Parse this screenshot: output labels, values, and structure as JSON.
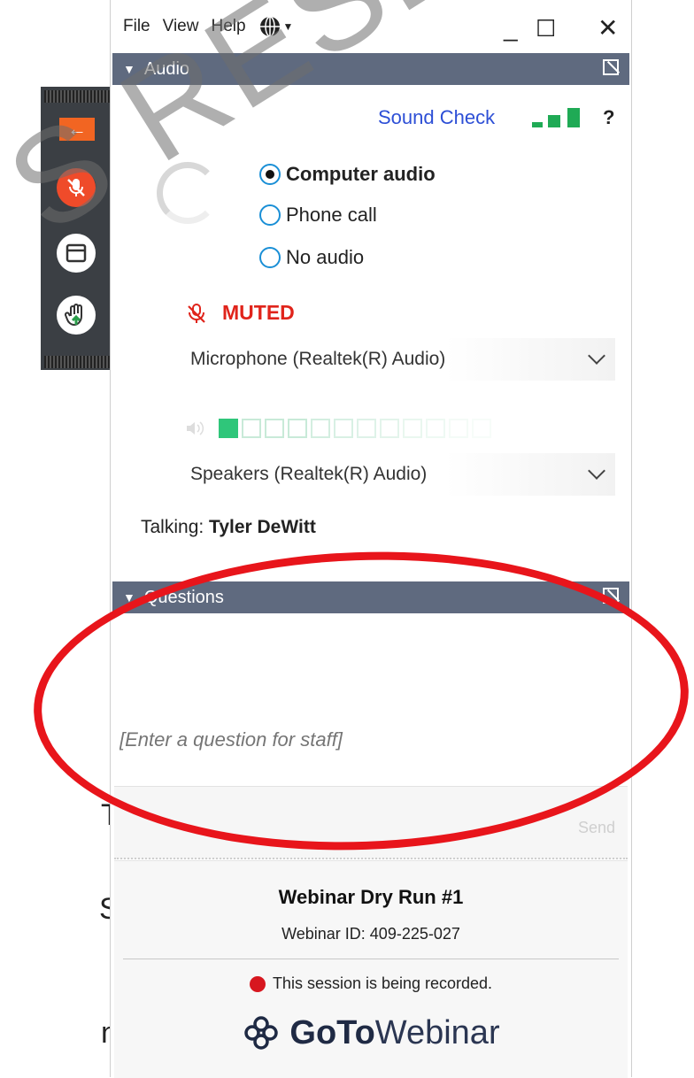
{
  "menu": {
    "file": "File",
    "view": "View",
    "help": "Help",
    "language_icon": "globe-icon"
  },
  "window_controls": {
    "minimize": "_",
    "maximize": "☐",
    "close": "✕"
  },
  "audio": {
    "header": "Audio",
    "sound_check": "Sound Check",
    "help": "?",
    "options": [
      {
        "label": "Computer audio",
        "selected": true
      },
      {
        "label": "Phone call",
        "selected": false
      },
      {
        "label": "No audio",
        "selected": false
      }
    ],
    "muted_label": "MUTED",
    "microphone": "Microphone (Realtek(R) Audio)",
    "speakers": "Speakers (Realtek(R) Audio)",
    "speaker_level_active_cells": 1,
    "talking_label": "Talking:",
    "talking_name": "Tyler DeWitt"
  },
  "questions": {
    "header": "Questions",
    "placeholder": "[Enter a question for staff]",
    "send": "Send"
  },
  "footer": {
    "webinar_title": "Webinar Dry Run #1",
    "webinar_id": "Webinar ID: 409-225-027",
    "recording": "This session is being recorded.",
    "brand_bold": "GoTo",
    "brand_light": "Webinar"
  },
  "colors": {
    "header_bg": "#5f6a7f",
    "muted_red": "#e0241b",
    "link_blue": "#2d4fd6",
    "level_green": "#2fc67a",
    "annotation_red": "#e8151b"
  },
  "overlay": {
    "watermark": "S RESERVE"
  }
}
